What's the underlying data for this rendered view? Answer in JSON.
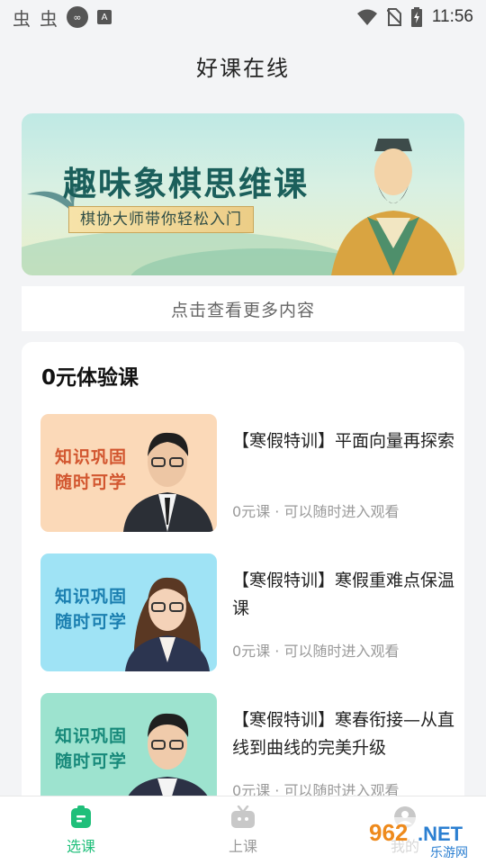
{
  "status_bar": {
    "left_glyphs": [
      "虫",
      "虫"
    ],
    "icons": [
      "infinity-icon",
      "font-a-icon"
    ],
    "right_icons": [
      "wifi-icon",
      "no-sim-icon",
      "battery-charging-icon"
    ],
    "time": "11:56"
  },
  "header": {
    "title": "好课在线"
  },
  "banner": {
    "title": "趣味象棋思维课",
    "subtitle": "棋协大师带你轻松入门"
  },
  "more_link": "点击查看更多内容",
  "free_section": {
    "title": "0元体验课",
    "courses": [
      {
        "thumb_text": "知识巩固随时可学",
        "title": "【寒假特训】平面向量再探索",
        "price": "0元课",
        "note": "可以随时进入观看",
        "thumb_bg": "#fbd9b8",
        "thumb_color": "#d2562f"
      },
      {
        "thumb_text": "知识巩固随时可学",
        "title": "【寒假特训】寒假重难点保温课",
        "price": "0元课",
        "note": "可以随时进入观看",
        "thumb_bg": "#9fe3f5",
        "thumb_color": "#1b7fb0"
      },
      {
        "thumb_text": "知识巩固随时可学",
        "title": "【寒假特训】寒春衔接—从直线到曲线的完美升级",
        "price": "0元课",
        "note": "可以随时进入观看",
        "thumb_bg": "#9de3cf",
        "thumb_color": "#17897a"
      }
    ],
    "meta_separator": "·"
  },
  "tabs": [
    {
      "label": "选课",
      "icon": "course-select-icon",
      "active": true
    },
    {
      "label": "上课",
      "icon": "tv-icon",
      "active": false
    },
    {
      "label": "我的",
      "icon": "profile-icon",
      "active": false
    }
  ],
  "colors": {
    "accent": "#1fbf7a",
    "inactive": "#9b9b9b"
  },
  "watermark": {
    "text": "962.NET",
    "sub": "乐游网"
  }
}
